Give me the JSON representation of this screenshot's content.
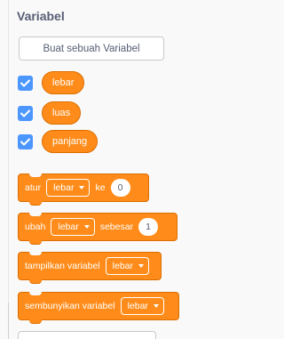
{
  "category": {
    "title": "Variabel"
  },
  "make_variable_button": {
    "label": "Buat sebuah Variabel"
  },
  "variables": [
    {
      "name": "lebar",
      "checked": true
    },
    {
      "name": "luas",
      "checked": true
    },
    {
      "name": "panjang",
      "checked": true
    }
  ],
  "blocks": {
    "set": {
      "label": "atur",
      "variable": "lebar",
      "to_label": "ke",
      "value": "0"
    },
    "change": {
      "label": "ubah",
      "variable": "lebar",
      "by_label": "sebesar",
      "value": "1"
    },
    "show": {
      "label": "tampilkan variabel",
      "variable": "lebar"
    },
    "hide": {
      "label": "sembunyikan variabel",
      "variable": "lebar"
    }
  },
  "colors": {
    "variables_block": "#ff8c1a",
    "variables_block_border": "#db6e00",
    "checkbox": "#4c97ff",
    "title_text": "#575e75",
    "palette_background": "#f9f9f9"
  },
  "icons": {
    "checkbox": "checkmark-icon",
    "dropdown": "caret-down-icon"
  }
}
